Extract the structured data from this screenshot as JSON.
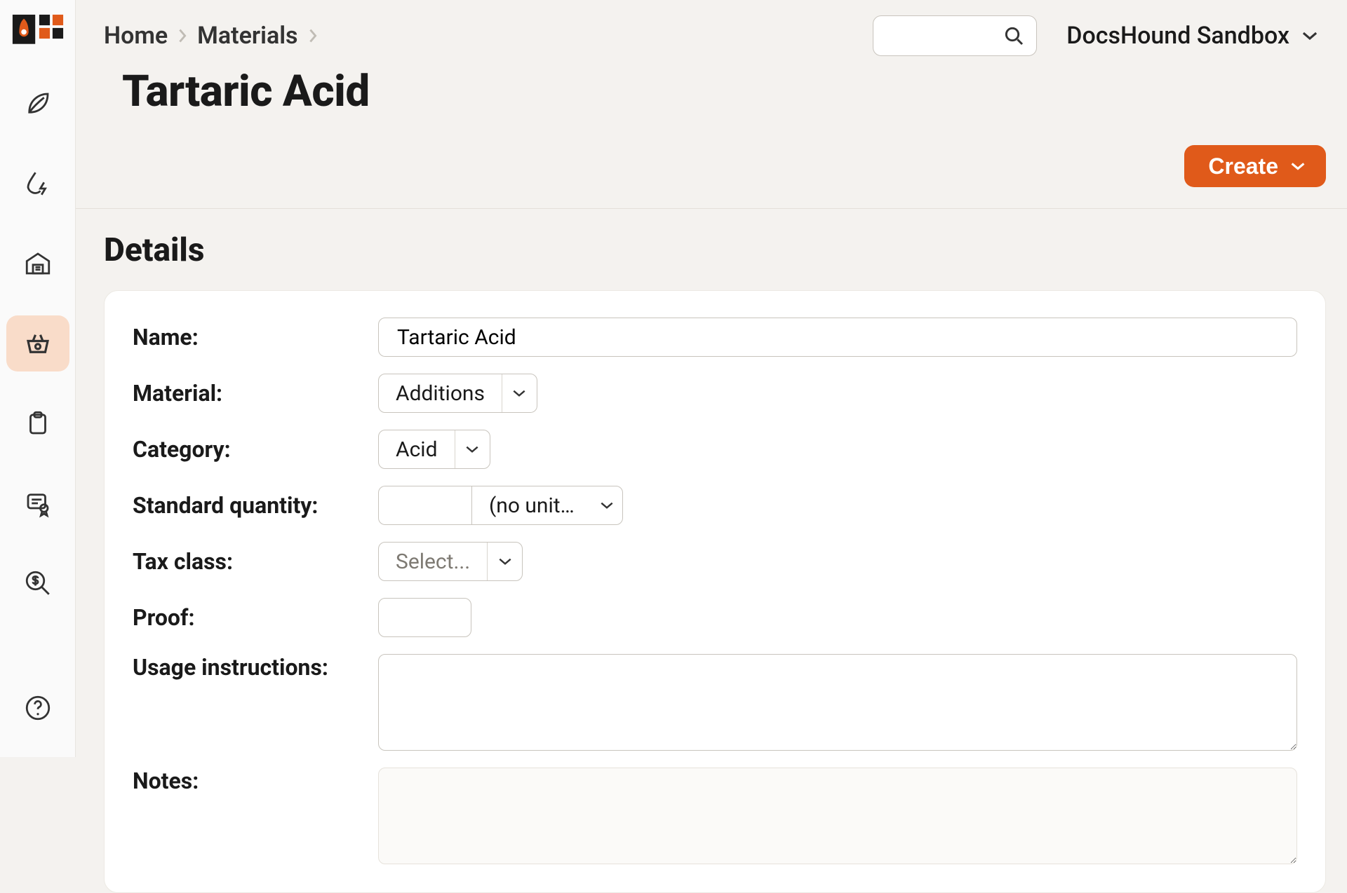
{
  "breadcrumbs": {
    "home": "Home",
    "materials": "Materials"
  },
  "page_title": "Tartaric Acid",
  "org_name": "DocsHound Sandbox",
  "create_button": "Create",
  "section_details": "Details",
  "labels": {
    "name": "Name:",
    "material": "Material:",
    "category": "Category:",
    "std_qty": "Standard quantity:",
    "tax_class": "Tax class:",
    "proof": "Proof:",
    "usage": "Usage instructions:",
    "notes": "Notes:"
  },
  "values": {
    "name": "Tartaric Acid",
    "material": "Additions",
    "category": "Acid",
    "std_qty_value": "",
    "std_qty_unit": "(no unit…",
    "tax_class": "Select...",
    "proof": "",
    "usage": "",
    "notes": ""
  }
}
